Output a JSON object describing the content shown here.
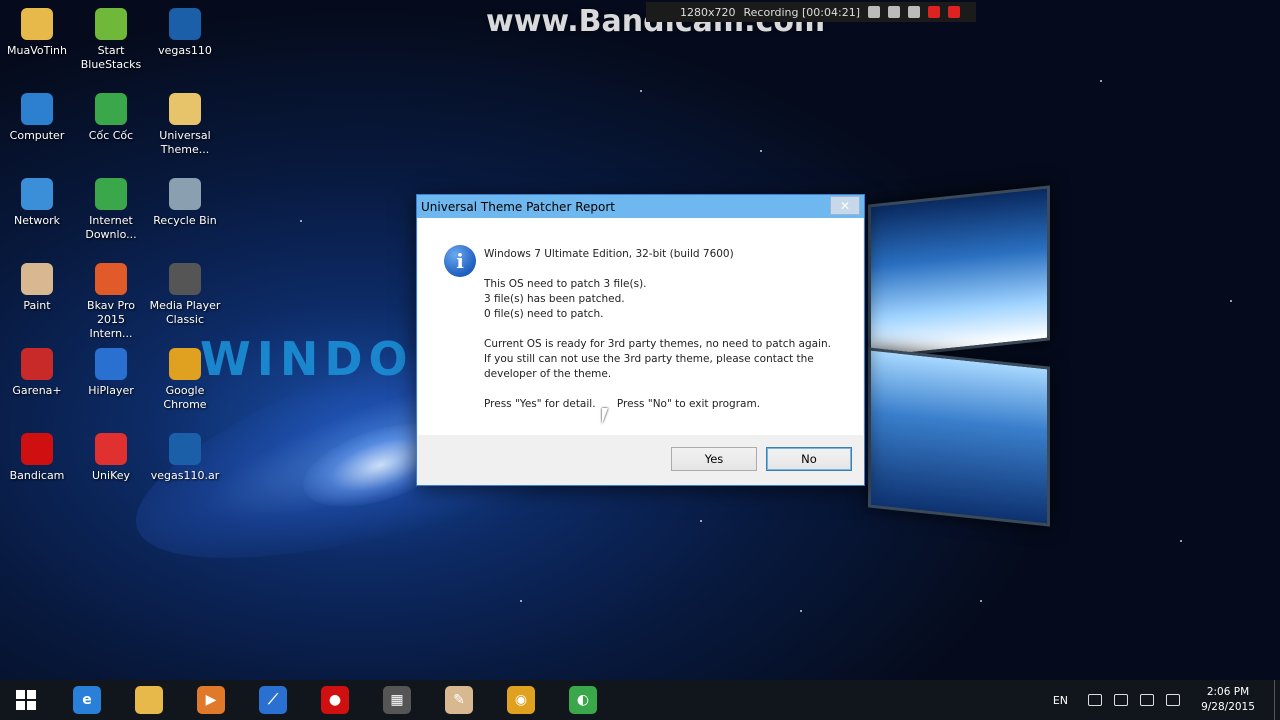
{
  "watermark": "www.Bandicam.com",
  "recording": {
    "resolution": "1280x720",
    "status": "Recording [00:04:21]"
  },
  "desktop_background_text": "WINDO",
  "desktop_icons": [
    {
      "label": "MuaVoTinh",
      "icon": "folder-icon",
      "color": "#e7b84a"
    },
    {
      "label": "Start BlueStacks",
      "icon": "bluestacks-icon",
      "color": "#6fb83a"
    },
    {
      "label": "vegas110",
      "icon": "vegas-icon",
      "color": "#1a5fa8"
    },
    {
      "label": "Computer",
      "icon": "computer-icon",
      "color": "#2d7fd0"
    },
    {
      "label": "Cốc Cốc",
      "icon": "coccoc-icon",
      "color": "#3aa84a"
    },
    {
      "label": "Universal Theme...",
      "icon": "folder-icon",
      "color": "#e7c36a"
    },
    {
      "label": "Network",
      "icon": "network-icon",
      "color": "#3a8fd8"
    },
    {
      "label": "Internet Downlo...",
      "icon": "idm-icon",
      "color": "#3aa84a"
    },
    {
      "label": "Recycle Bin",
      "icon": "recycle-bin-icon",
      "color": "#8aa0b0"
    },
    {
      "label": "Paint",
      "icon": "paint-icon",
      "color": "#d8b890"
    },
    {
      "label": "Bkav Pro 2015 Intern...",
      "icon": "bkav-icon",
      "color": "#e05a2a"
    },
    {
      "label": "Media Player Classic",
      "icon": "media-player-icon",
      "color": "#555555"
    },
    {
      "label": "Garena+",
      "icon": "garena-icon",
      "color": "#c82a2a"
    },
    {
      "label": "HiPlayer",
      "icon": "hiplayer-icon",
      "color": "#2a70d0"
    },
    {
      "label": "Google Chrome",
      "icon": "chrome-icon",
      "color": "#e0a020"
    },
    {
      "label": "Bandicam",
      "icon": "bandicam-icon",
      "color": "#d01010"
    },
    {
      "label": "UniKey",
      "icon": "unikey-icon",
      "color": "#e03030"
    },
    {
      "label": "vegas110.ar",
      "icon": "vegas-icon",
      "color": "#1a5fa8"
    }
  ],
  "dialog": {
    "title": "Universal Theme Patcher Report",
    "close_glyph": "✕",
    "line1": "Windows 7 Ultimate Edition, 32-bit (build 7600)",
    "line2": "This OS need to patch 3 file(s).",
    "line3": " 3 file(s) has been patched.",
    "line4": " 0 file(s) need to  patch.",
    "line5": "Current OS is ready for 3rd party themes, no need to patch again.",
    "line6": "If you still can not use the 3rd party theme, please contact the",
    "line7": "developer of the theme.",
    "line8a": "Press \"Yes\" for detail.",
    "line8b": "Press \"No\" to exit program.",
    "yes_label": "Yes",
    "no_label": "No"
  },
  "taskbar": {
    "items": [
      {
        "icon": "internet-explorer-icon",
        "color": "#2a7fd8",
        "glyph": "e"
      },
      {
        "icon": "file-explorer-icon",
        "color": "#e7b84a",
        "glyph": ""
      },
      {
        "icon": "media-icon",
        "color": "#e07a2a",
        "glyph": "▶"
      },
      {
        "icon": "hiplayer-icon",
        "color": "#2a70d0",
        "glyph": "⟋"
      },
      {
        "icon": "bandicam-icon",
        "color": "#d01010",
        "glyph": "●"
      },
      {
        "icon": "media-player-icon",
        "color": "#555555",
        "glyph": "▦"
      },
      {
        "icon": "paint-icon",
        "color": "#d8b890",
        "glyph": "✎"
      },
      {
        "icon": "chrome-icon",
        "color": "#e0a020",
        "glyph": "◉"
      },
      {
        "icon": "coccoc-icon",
        "color": "#3aa84a",
        "glyph": "◐"
      }
    ],
    "language": "EN",
    "time": "2:06 PM",
    "date": "9/28/2015"
  }
}
